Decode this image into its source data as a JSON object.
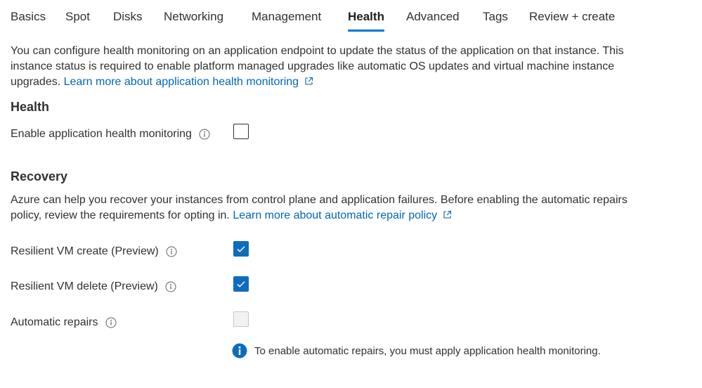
{
  "tabs": [
    {
      "label": "Basics",
      "active": false
    },
    {
      "label": "Spot",
      "active": false
    },
    {
      "label": "Disks",
      "active": false
    },
    {
      "label": "Networking",
      "active": false
    },
    {
      "label": "Management",
      "active": false
    },
    {
      "label": "Health",
      "active": true
    },
    {
      "label": "Advanced",
      "active": false
    },
    {
      "label": "Tags",
      "active": false
    },
    {
      "label": "Review + create",
      "active": false
    }
  ],
  "intro": {
    "line1": "You can configure health monitoring on an application endpoint to update the status of the application on that instance. This",
    "line2": "instance status is required to enable platform managed upgrades like automatic OS updates and virtual machine instance",
    "line3": "upgrades.",
    "link": "Learn more about application health monitoring"
  },
  "health": {
    "title": "Health",
    "enable_monitoring_label": "Enable application health monitoring",
    "enable_monitoring_checked": false
  },
  "recovery": {
    "title": "Recovery",
    "line1": "Azure can help you recover your instances from control plane and application failures. Before enabling the automatic repairs",
    "line2": "policy, review the requirements for opting in.",
    "link": "Learn more about automatic repair policy",
    "resilient_create_label": "Resilient VM create (Preview)",
    "resilient_create_checked": true,
    "resilient_delete_label": "Resilient VM delete (Preview)",
    "resilient_delete_checked": true,
    "automatic_repairs_label": "Automatic repairs",
    "automatic_repairs_checked": false,
    "automatic_repairs_disabled": true,
    "notice": "To enable automatic repairs, you must apply application health monitoring."
  },
  "colors": {
    "accent": "#0078d4",
    "link": "#0067b8",
    "checkbox_checked": "#0f6cbd",
    "info_icon": "#0f6cbd"
  },
  "icons": {
    "external_link": "external-link-icon",
    "info": "info-icon",
    "checkmark": "checkmark-icon",
    "info_filled": "info-filled-icon"
  }
}
